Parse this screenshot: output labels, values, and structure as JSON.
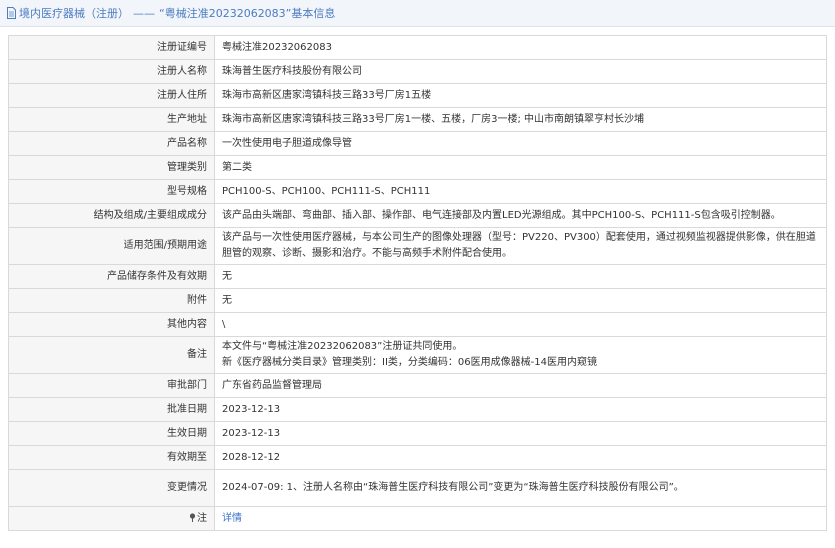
{
  "header": {
    "section": "境内医疗器械（注册）",
    "separator": "——",
    "title": "“粤械注准20232062083”基本信息"
  },
  "rows": [
    {
      "label": "注册证编号",
      "value": "粤械注准20232062083"
    },
    {
      "label": "注册人名称",
      "value": "珠海普生医疗科技股份有限公司"
    },
    {
      "label": "注册人住所",
      "value": "珠海市高新区唐家湾镇科技三路33号厂房1五楼"
    },
    {
      "label": "生产地址",
      "value": "珠海市高新区唐家湾镇科技三路33号厂房1一楼、五楼，厂房3一楼; 中山市南朗镇翠亨村长沙埔"
    },
    {
      "label": "产品名称",
      "value": "一次性使用电子胆道成像导管"
    },
    {
      "label": "管理类别",
      "value": "第二类"
    },
    {
      "label": "型号规格",
      "value": "PCH100-S、PCH100、PCH111-S、PCH111"
    },
    {
      "label": "结构及组成/主要组成成分",
      "value": "该产品由头端部、弯曲部、插入部、操作部、电气连接部及内置LED光源组成。其中PCH100-S、PCH111-S包含吸引控制器。"
    },
    {
      "label": "适用范围/预期用途",
      "value": "该产品与一次性使用医疗器械，与本公司生产的图像处理器（型号：PV220、PV300）配套使用，通过视频监视器提供影像，供在胆道胆管的观察、诊断、摄影和治疗。不能与高频手术附件配合使用。"
    },
    {
      "label": "产品储存条件及有效期",
      "value": "无"
    },
    {
      "label": "附件",
      "value": "无"
    },
    {
      "label": "其他内容",
      "value": "\\"
    },
    {
      "label": "备注",
      "lines": [
        "本文件与“粤械注准20232062083”注册证共同使用。",
        "新《医疗器械分类目录》管理类别：II类，分类编码：06医用成像器械-14医用内窥镜"
      ]
    },
    {
      "label": "审批部门",
      "value": "广东省药品监督管理局"
    },
    {
      "label": "批准日期",
      "value": "2023-12-13"
    },
    {
      "label": "生效日期",
      "value": "2023-12-13"
    },
    {
      "label": "有效期至",
      "value": "2028-12-12"
    },
    {
      "label": "变更情况",
      "value": "2024-07-09: 1、注册人名称由“珠海普生医疗科技有限公司”变更为“珠海普生医疗科技股份有限公司”。"
    },
    {
      "label": "注",
      "value": "详情"
    }
  ],
  "colors": {
    "accent": "#4c7cc1",
    "link": "#3b72c9",
    "label_bg": "#f6f6f6",
    "border": "#d9d9d9"
  },
  "icons": {
    "header": "document-icon",
    "note": "pin-icon"
  }
}
